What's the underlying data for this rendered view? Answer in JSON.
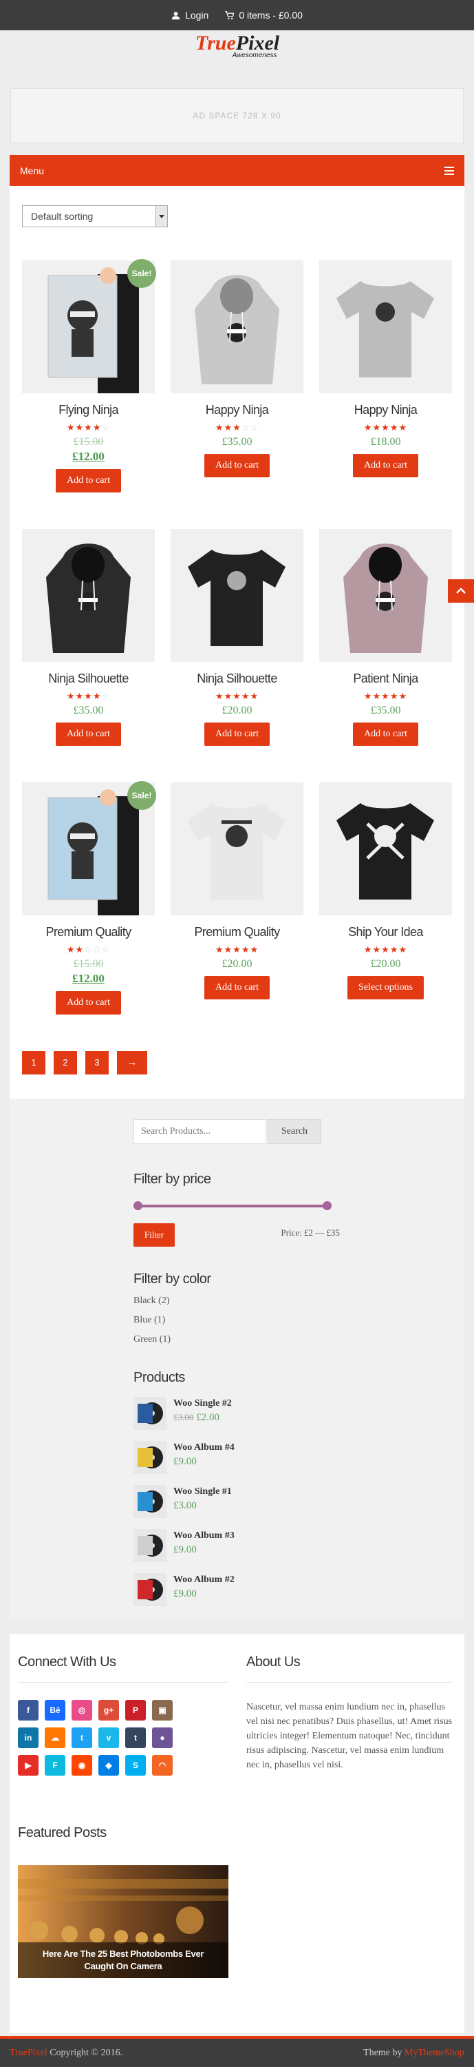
{
  "topbar": {
    "login": "Login",
    "cart": "0 items - £0.00"
  },
  "logo": {
    "part1": "True",
    "part2": "Pixel",
    "tagline": "Awesomeness"
  },
  "ad": {
    "text": "AD SPACE 728 X 90"
  },
  "menu": {
    "label": "Menu"
  },
  "sorting": {
    "selected": "Default sorting"
  },
  "products": [
    {
      "name": "Flying Ninja",
      "rating": 4,
      "old_price": "£15.00",
      "price": "£12.00",
      "sale": "Sale!",
      "button": "Add to cart",
      "art": "poster"
    },
    {
      "name": "Happy Ninja",
      "rating": 3,
      "price": "£35.00",
      "button": "Add to cart",
      "art": "hoodie-grey"
    },
    {
      "name": "Happy Ninja",
      "rating": 5,
      "price": "£18.00",
      "button": "Add to cart",
      "art": "tee-grey"
    },
    {
      "name": "Ninja Silhouette",
      "rating": 4,
      "price": "£35.00",
      "button": "Add to cart",
      "art": "hoodie-black"
    },
    {
      "name": "Ninja Silhouette",
      "rating": 5,
      "price": "£20.00",
      "button": "Add to cart",
      "art": "tee-black"
    },
    {
      "name": "Patient Ninja",
      "rating": 5,
      "price": "£35.00",
      "button": "Add to cart",
      "art": "hoodie-pink"
    },
    {
      "name": "Premium Quality",
      "rating": 2,
      "old_price": "£15.00",
      "price": "£12.00",
      "sale": "Sale!",
      "button": "Add to cart",
      "art": "poster-blue"
    },
    {
      "name": "Premium Quality",
      "rating": 5,
      "price": "£20.00",
      "button": "Add to cart",
      "art": "tee-white"
    },
    {
      "name": "Ship Your Idea",
      "rating": 4.5,
      "price": "£20.00",
      "button": "Select options",
      "art": "tee-black-skull"
    }
  ],
  "pagination": [
    "1",
    "2",
    "3",
    "→"
  ],
  "sidebar": {
    "search_placeholder": "Search Products...",
    "search_button": "Search",
    "price_title": "Filter by price",
    "filter_button": "Filter",
    "price_range": "Price: £2 — £35",
    "color_title": "Filter by color",
    "colors": [
      "Black (2)",
      "Blue (1)",
      "Green (1)"
    ],
    "products_title": "Products",
    "products": [
      {
        "name": "Woo Single #2",
        "old": "£3.00",
        "price": "£2.00",
        "color": "#2a5aa0"
      },
      {
        "name": "Woo Album #4",
        "price": "£9.00",
        "color": "#e7c03a"
      },
      {
        "name": "Woo Single #1",
        "price": "£3.00",
        "color": "#2a8fd0"
      },
      {
        "name": "Woo Album #3",
        "price": "£9.00",
        "color": "#cfcfcf"
      },
      {
        "name": "Woo Album #2",
        "price": "£9.00",
        "color": "#d0282a"
      }
    ]
  },
  "footer": {
    "connect_title": "Connect With Us",
    "about_title": "About Us",
    "about_text": "Nascetur, vel massa enim lundium nec in, phasellus vel nisi nec penatibus? Duis phasellus, ut! Amet risus ultricies integer! Elementum natoque! Nec, tincidunt risus adipiscing. Nascetur, vel massa enim lundium nec in, phasellus vel nisi.",
    "featured_title": "Featured Posts",
    "featured_caption": "Here Are The 25 Best Photobombs Ever Caught On Camera",
    "social": [
      {
        "icon": "facebook-icon",
        "glyph": "f",
        "color": "#3b5998"
      },
      {
        "icon": "behance-icon",
        "glyph": "Bē",
        "color": "#1769ff"
      },
      {
        "icon": "dribbble-icon",
        "glyph": "◎",
        "color": "#ea4c89"
      },
      {
        "icon": "google-plus-icon",
        "glyph": "g+",
        "color": "#dd4b39"
      },
      {
        "icon": "pinterest-icon",
        "glyph": "P",
        "color": "#cb2027"
      },
      {
        "icon": "instagram-icon",
        "glyph": "▣",
        "color": "#8a6a4e"
      },
      {
        "icon": "linkedin-icon",
        "glyph": "in",
        "color": "#0e76a8"
      },
      {
        "icon": "soundcloud-icon",
        "glyph": "☁",
        "color": "#ff7700"
      },
      {
        "icon": "twitter-icon",
        "glyph": "t",
        "color": "#1da1f2"
      },
      {
        "icon": "vimeo-icon",
        "glyph": "v",
        "color": "#1ab7ea"
      },
      {
        "icon": "tumblr-icon",
        "glyph": "t",
        "color": "#35465c"
      },
      {
        "icon": "github-icon",
        "glyph": "●",
        "color": "#6e5494"
      },
      {
        "icon": "youtube-icon",
        "glyph": "▶",
        "color": "#e52d27"
      },
      {
        "icon": "foursquare-icon",
        "glyph": "F",
        "color": "#0cbadf"
      },
      {
        "icon": "reddit-icon",
        "glyph": "◉",
        "color": "#ff4500"
      },
      {
        "icon": "dropbox-icon",
        "glyph": "◆",
        "color": "#007ee5"
      },
      {
        "icon": "skype-icon",
        "glyph": "S",
        "color": "#00aff0"
      },
      {
        "icon": "rss-icon",
        "glyph": "◠",
        "color": "#f26522"
      }
    ]
  },
  "bottom": {
    "brand": "TruePixel",
    "copyright": "Copyright © 2016.",
    "theme_by": "Theme by",
    "theme_link": "MyThemeShop"
  }
}
